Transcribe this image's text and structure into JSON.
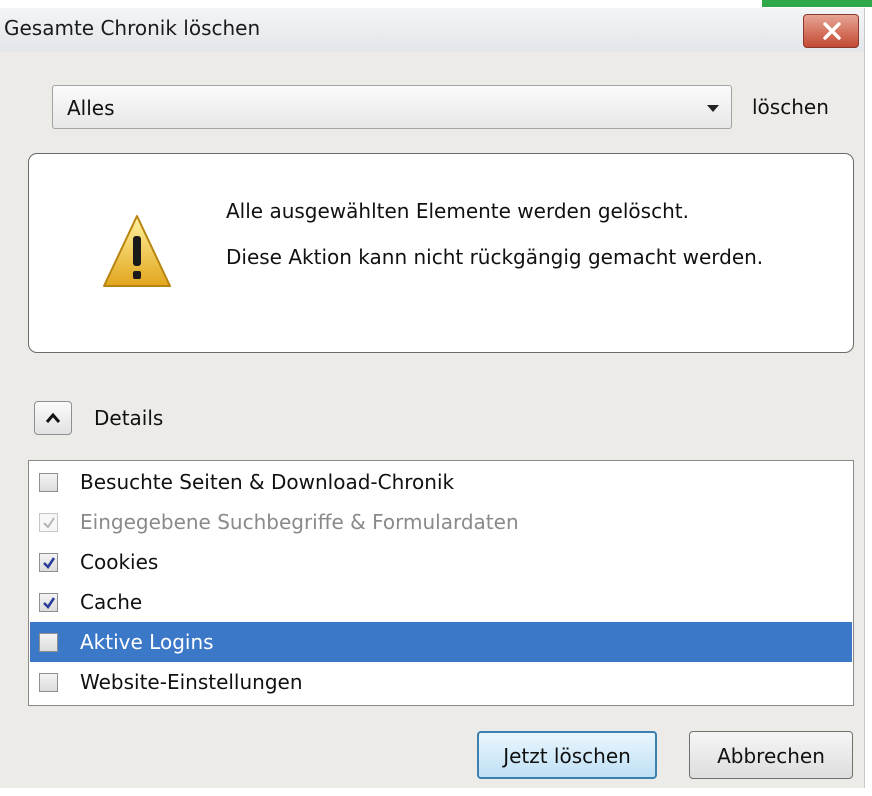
{
  "window": {
    "title": "Gesamte Chronik löschen"
  },
  "time_range": {
    "selected": "Alles",
    "suffix_label": "löschen"
  },
  "warning": {
    "line1": "Alle ausgewählten Elemente werden gelöscht.",
    "line2": "Diese Aktion kann nicht rückgängig gemacht werden."
  },
  "details": {
    "label": "Details",
    "expanded": true
  },
  "items": [
    {
      "label": "Besuchte Seiten & Download-Chronik",
      "checked": false,
      "disabled": false,
      "selected": false
    },
    {
      "label": "Eingegebene Suchbegriffe & Formulardaten",
      "checked": true,
      "disabled": true,
      "selected": false
    },
    {
      "label": "Cookies",
      "checked": true,
      "disabled": false,
      "selected": false
    },
    {
      "label": "Cache",
      "checked": true,
      "disabled": false,
      "selected": false
    },
    {
      "label": "Aktive Logins",
      "checked": false,
      "disabled": false,
      "selected": true
    },
    {
      "label": "Website-Einstellungen",
      "checked": false,
      "disabled": false,
      "selected": false
    }
  ],
  "buttons": {
    "confirm": "Jetzt löschen",
    "cancel": "Abbrechen"
  },
  "colors": {
    "selection": "#3c78c8",
    "close_button": "#c24a33",
    "accent_corner": "#2fa84a"
  }
}
